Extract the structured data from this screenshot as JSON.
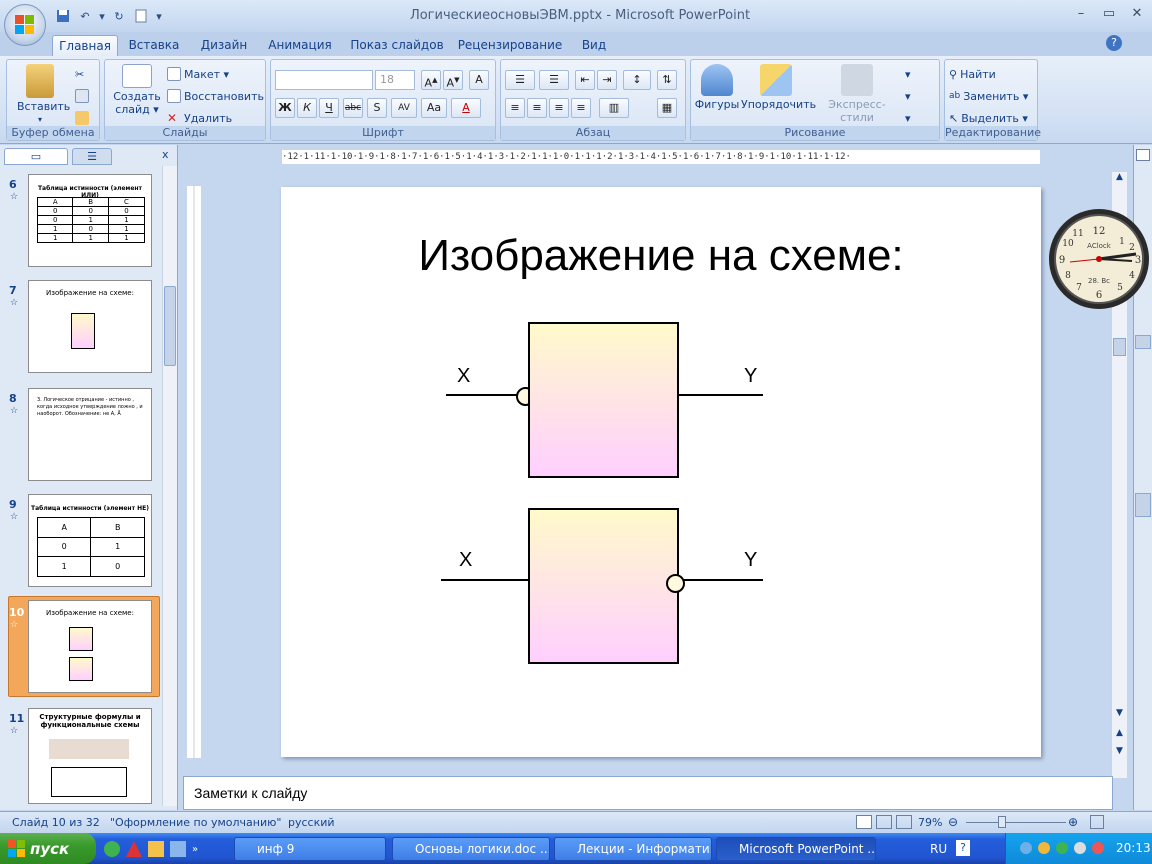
{
  "window": {
    "title": "ЛогическиеосновыЭВМ.pptx - Microsoft PowerPoint",
    "controls": [
      "–",
      "▭",
      "✕"
    ]
  },
  "tabs": [
    "Главная",
    "Вставка",
    "Дизайн",
    "Анимация",
    "Показ слайдов",
    "Рецензирование",
    "Вид"
  ],
  "active_tab": "Главная",
  "ribbon": {
    "clipboard": {
      "paste": "Вставить",
      "label": "Буфер обмена"
    },
    "slides": {
      "new_slide_1": "Создать",
      "new_slide_2": "слайд ▾",
      "layout": "Макет ▾",
      "reset": "Восстановить",
      "delete": "Удалить",
      "label": "Слайды"
    },
    "font": {
      "size": "18",
      "label": "Шрифт",
      "bold": "Ж",
      "italic": "К",
      "underline": "Ч",
      "strike": "abc",
      "shadow": "S",
      "spacing": "AV",
      "case": "Aa",
      "color": "A"
    },
    "paragraph": {
      "label": "Абзац"
    },
    "drawing": {
      "shapes": "Фигуры",
      "arrange": "Упорядочить",
      "quick_styles": "Экспресс-стили",
      "label": "Рисование"
    },
    "editing": {
      "find": "Найти",
      "replace": "Заменить ▾",
      "select": "Выделить ▾",
      "label": "Редактирование"
    }
  },
  "thumbnails": [
    {
      "num": "6",
      "title": "Таблица истинности (элемент ИЛИ)",
      "headers": [
        "A",
        "B",
        "C"
      ],
      "rows": [
        [
          "0",
          "0",
          "0"
        ],
        [
          "0",
          "1",
          "1"
        ],
        [
          "1",
          "0",
          "1"
        ],
        [
          "1",
          "1",
          "1"
        ]
      ]
    },
    {
      "num": "7",
      "title": "Изображение на схеме:"
    },
    {
      "num": "8",
      "title": "3.   Логическое отрицание - истинно , когда исходное утверждение ложно , и наоборот. Обозначение: не A, Ā"
    },
    {
      "num": "9",
      "title": "Таблица истинности (элемент НЕ)",
      "headers": [
        "A",
        "B"
      ],
      "rows": [
        [
          "0",
          "1"
        ],
        [
          "1",
          "0"
        ]
      ]
    },
    {
      "num": "10",
      "title": "Изображение на схеме:"
    },
    {
      "num": "11",
      "title": "Структурные формулы и функциональные схемы"
    }
  ],
  "ruler": "·12·1·11·1·10·1·9·1·8·1·7·1·6·1·5·1·4·1·3·1·2·1·1·1·0·1·1·1·2·1·3·1·4·1·5·1·6·1·7·1·8·1·9·1·10·1·11·1·12·",
  "slide": {
    "title": "Изображение на схеме:",
    "x_label": "X",
    "y_label": "Y"
  },
  "clock": {
    "name": "AClock",
    "date": "28. Вс"
  },
  "notes_placeholder": "Заметки к слайду",
  "status": {
    "slide": "Слайд 10 из 32",
    "theme": "\"Оформление по умолчанию\"",
    "lang": "русский",
    "zoom": "79%"
  },
  "taskbar": {
    "start": "пуск",
    "items": [
      "инф 9",
      "Основы логики.doc ...",
      "Лекции - Информати...",
      "Microsoft PowerPoint ..."
    ],
    "lang": "RU",
    "time": "20:13"
  }
}
